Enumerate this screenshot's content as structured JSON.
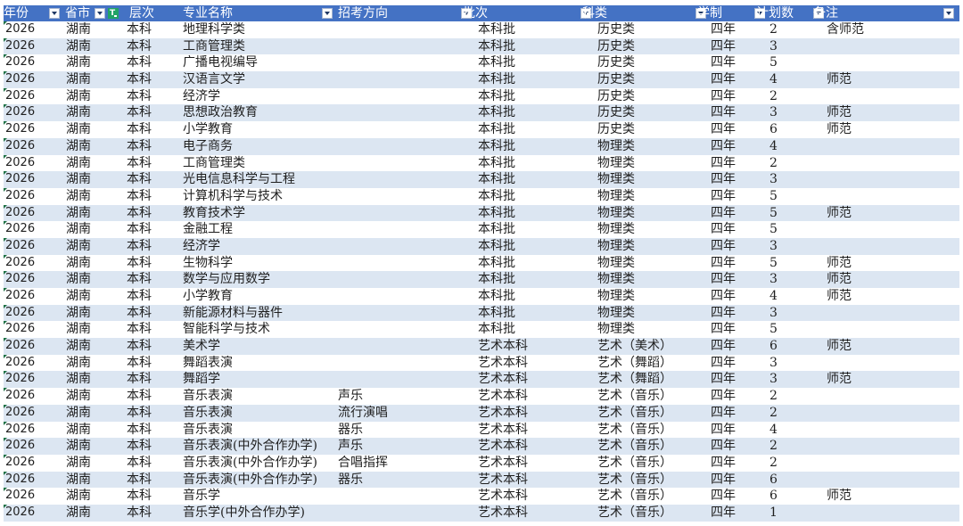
{
  "header": {
    "columns": [
      {
        "key": "year",
        "label": "年份",
        "filter": "dropdown"
      },
      {
        "key": "province",
        "label": "省市",
        "filter": "dropdown"
      },
      {
        "key": "level",
        "label": "层次",
        "filter": "text-filter-active"
      },
      {
        "key": "major",
        "label": "专业名称",
        "filter": "dropdown"
      },
      {
        "key": "direction",
        "label": "招考方向",
        "filter": "dropdown"
      },
      {
        "key": "batch",
        "label": "批次",
        "filter": "dropdown"
      },
      {
        "key": "category",
        "label": "科类",
        "filter": "dropdown"
      },
      {
        "key": "duration",
        "label": "学制",
        "filter": "dropdown"
      },
      {
        "key": "plan",
        "label": "计划数",
        "filter": "dropdown"
      },
      {
        "key": "note",
        "label": "备注",
        "filter": "dropdown"
      }
    ]
  },
  "rows": [
    {
      "year": "2026",
      "province": "湖南",
      "level": "本科",
      "major": "地理科学类",
      "direction": "",
      "batch": "本科批",
      "category": "历史类",
      "duration": "四年",
      "plan": "2",
      "note": "含师范"
    },
    {
      "year": "2026",
      "province": "湖南",
      "level": "本科",
      "major": "工商管理类",
      "direction": "",
      "batch": "本科批",
      "category": "历史类",
      "duration": "四年",
      "plan": "3",
      "note": ""
    },
    {
      "year": "2026",
      "province": "湖南",
      "level": "本科",
      "major": "广播电视编导",
      "direction": "",
      "batch": "本科批",
      "category": "历史类",
      "duration": "四年",
      "plan": "5",
      "note": ""
    },
    {
      "year": "2026",
      "province": "湖南",
      "level": "本科",
      "major": "汉语言文学",
      "direction": "",
      "batch": "本科批",
      "category": "历史类",
      "duration": "四年",
      "plan": "4",
      "note": "师范"
    },
    {
      "year": "2026",
      "province": "湖南",
      "level": "本科",
      "major": "经济学",
      "direction": "",
      "batch": "本科批",
      "category": "历史类",
      "duration": "四年",
      "plan": "2",
      "note": ""
    },
    {
      "year": "2026",
      "province": "湖南",
      "level": "本科",
      "major": "思想政治教育",
      "direction": "",
      "batch": "本科批",
      "category": "历史类",
      "duration": "四年",
      "plan": "3",
      "note": "师范"
    },
    {
      "year": "2026",
      "province": "湖南",
      "level": "本科",
      "major": "小学教育",
      "direction": "",
      "batch": "本科批",
      "category": "历史类",
      "duration": "四年",
      "plan": "6",
      "note": "师范"
    },
    {
      "year": "2026",
      "province": "湖南",
      "level": "本科",
      "major": "电子商务",
      "direction": "",
      "batch": "本科批",
      "category": "物理类",
      "duration": "四年",
      "plan": "4",
      "note": ""
    },
    {
      "year": "2026",
      "province": "湖南",
      "level": "本科",
      "major": "工商管理类",
      "direction": "",
      "batch": "本科批",
      "category": "物理类",
      "duration": "四年",
      "plan": "2",
      "note": ""
    },
    {
      "year": "2026",
      "province": "湖南",
      "level": "本科",
      "major": "光电信息科学与工程",
      "direction": "",
      "batch": "本科批",
      "category": "物理类",
      "duration": "四年",
      "plan": "3",
      "note": ""
    },
    {
      "year": "2026",
      "province": "湖南",
      "level": "本科",
      "major": "计算机科学与技术",
      "direction": "",
      "batch": "本科批",
      "category": "物理类",
      "duration": "四年",
      "plan": "5",
      "note": ""
    },
    {
      "year": "2026",
      "province": "湖南",
      "level": "本科",
      "major": "教育技术学",
      "direction": "",
      "batch": "本科批",
      "category": "物理类",
      "duration": "四年",
      "plan": "5",
      "note": "师范"
    },
    {
      "year": "2026",
      "province": "湖南",
      "level": "本科",
      "major": "金融工程",
      "direction": "",
      "batch": "本科批",
      "category": "物理类",
      "duration": "四年",
      "plan": "5",
      "note": ""
    },
    {
      "year": "2026",
      "province": "湖南",
      "level": "本科",
      "major": "经济学",
      "direction": "",
      "batch": "本科批",
      "category": "物理类",
      "duration": "四年",
      "plan": "3",
      "note": ""
    },
    {
      "year": "2026",
      "province": "湖南",
      "level": "本科",
      "major": "生物科学",
      "direction": "",
      "batch": "本科批",
      "category": "物理类",
      "duration": "四年",
      "plan": "5",
      "note": "师范"
    },
    {
      "year": "2026",
      "province": "湖南",
      "level": "本科",
      "major": "数学与应用数学",
      "direction": "",
      "batch": "本科批",
      "category": "物理类",
      "duration": "四年",
      "plan": "3",
      "note": "师范"
    },
    {
      "year": "2026",
      "province": "湖南",
      "level": "本科",
      "major": "小学教育",
      "direction": "",
      "batch": "本科批",
      "category": "物理类",
      "duration": "四年",
      "plan": "4",
      "note": "师范"
    },
    {
      "year": "2026",
      "province": "湖南",
      "level": "本科",
      "major": "新能源材料与器件",
      "direction": "",
      "batch": "本科批",
      "category": "物理类",
      "duration": "四年",
      "plan": "3",
      "note": ""
    },
    {
      "year": "2026",
      "province": "湖南",
      "level": "本科",
      "major": "智能科学与技术",
      "direction": "",
      "batch": "本科批",
      "category": "物理类",
      "duration": "四年",
      "plan": "5",
      "note": ""
    },
    {
      "year": "2026",
      "province": "湖南",
      "level": "本科",
      "major": "美术学",
      "direction": "",
      "batch": "艺术本科",
      "category": "艺术（美术）",
      "duration": "四年",
      "plan": "6",
      "note": "师范"
    },
    {
      "year": "2026",
      "province": "湖南",
      "level": "本科",
      "major": "舞蹈表演",
      "direction": "",
      "batch": "艺术本科",
      "category": "艺术（舞蹈）",
      "duration": "四年",
      "plan": "3",
      "note": ""
    },
    {
      "year": "2026",
      "province": "湖南",
      "level": "本科",
      "major": "舞蹈学",
      "direction": "",
      "batch": "艺术本科",
      "category": "艺术（舞蹈）",
      "duration": "四年",
      "plan": "3",
      "note": "师范"
    },
    {
      "year": "2026",
      "province": "湖南",
      "level": "本科",
      "major": "音乐表演",
      "direction": "声乐",
      "batch": "艺术本科",
      "category": "艺术（音乐）",
      "duration": "四年",
      "plan": "2",
      "note": ""
    },
    {
      "year": "2026",
      "province": "湖南",
      "level": "本科",
      "major": "音乐表演",
      "direction": "流行演唱",
      "batch": "艺术本科",
      "category": "艺术（音乐）",
      "duration": "四年",
      "plan": "2",
      "note": ""
    },
    {
      "year": "2026",
      "province": "湖南",
      "level": "本科",
      "major": "音乐表演",
      "direction": "器乐",
      "batch": "艺术本科",
      "category": "艺术（音乐）",
      "duration": "四年",
      "plan": "4",
      "note": ""
    },
    {
      "year": "2026",
      "province": "湖南",
      "level": "本科",
      "major": "音乐表演(中外合作办学)",
      "direction": "声乐",
      "batch": "艺术本科",
      "category": "艺术（音乐）",
      "duration": "四年",
      "plan": "2",
      "note": ""
    },
    {
      "year": "2026",
      "province": "湖南",
      "level": "本科",
      "major": "音乐表演(中外合作办学)",
      "direction": "合唱指挥",
      "batch": "艺术本科",
      "category": "艺术（音乐）",
      "duration": "四年",
      "plan": "2",
      "note": ""
    },
    {
      "year": "2026",
      "province": "湖南",
      "level": "本科",
      "major": "音乐表演(中外合作办学)",
      "direction": "器乐",
      "batch": "艺术本科",
      "category": "艺术（音乐）",
      "duration": "四年",
      "plan": "6",
      "note": ""
    },
    {
      "year": "2026",
      "province": "湖南",
      "level": "本科",
      "major": "音乐学",
      "direction": "",
      "batch": "艺术本科",
      "category": "艺术（音乐）",
      "duration": "四年",
      "plan": "6",
      "note": "师范"
    },
    {
      "year": "2026",
      "province": "湖南",
      "level": "本科",
      "major": "音乐学(中外合作办学)",
      "direction": "",
      "batch": "艺术本科",
      "category": "艺术（音乐）",
      "duration": "四年",
      "plan": "1",
      "note": ""
    }
  ]
}
